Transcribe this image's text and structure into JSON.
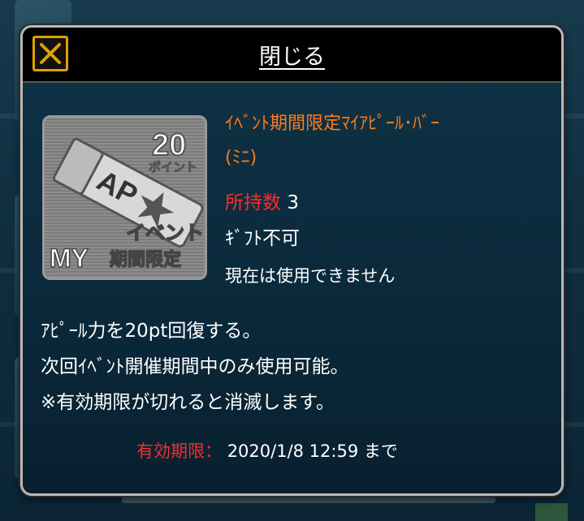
{
  "dialog": {
    "title": "閉じる",
    "item": {
      "name_line1": "ｲﾍﾞﾝﾄ期間限定ﾏｲｱﾋﾟｰﾙ･ﾊﾞｰ",
      "name_line2": "(ﾐﾆ)",
      "owned_label": "所持数",
      "owned_count": "3",
      "gift_status": "ｷﾞﾌﾄ不可",
      "usable_status": "現在は使用できません",
      "icon_text": {
        "points": "20",
        "points_unit": "ポイント",
        "ap": "AP",
        "event": "イベント",
        "my": "MY",
        "limited": "期間限定"
      }
    },
    "description": [
      "ｱﾋﾟｰﾙ力を20pt回復する。",
      "次回ｲﾍﾞﾝﾄ開催期間中のみ使用可能。",
      "※有効期限が切れると消滅します。"
    ],
    "expiry": {
      "label": "有効期限：",
      "value": "2020/1/8 12:59 まで"
    }
  },
  "colors": {
    "item_name": "#ff7a1a",
    "alert_label": "#ff2b2b",
    "close_border": "#e0a000",
    "dialog_bg": "#0b2a3c"
  },
  "icons": {
    "close": "close-x-icon"
  }
}
